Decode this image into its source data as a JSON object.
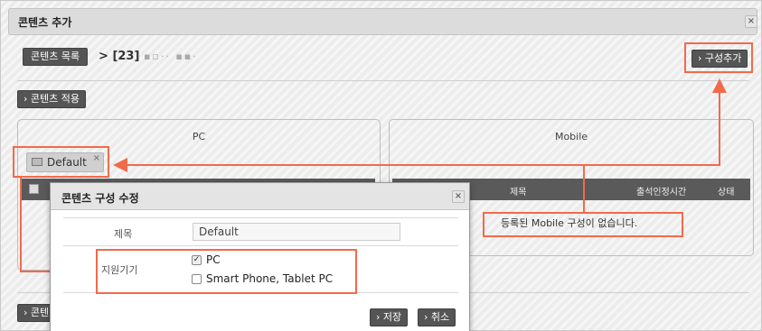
{
  "window": {
    "title": "콘텐츠 추가",
    "close": "×"
  },
  "breadcrumb": {
    "list_button": "콘텐츠 목록",
    "separator": ">",
    "current_id": "[23]",
    "current_title": "▪▫·· ▪▪·"
  },
  "toolbar": {
    "add_config": "› 구성추가",
    "apply_content": "› 콘텐츠 적용",
    "apply_content_cut": "› 콘텐"
  },
  "panels": {
    "pc": "PC",
    "mobile": "Mobile"
  },
  "pc_item": {
    "label": "Default",
    "remove": "×"
  },
  "mobile_grid": {
    "columns": [
      "제목",
      "출석인정시간",
      "상태"
    ],
    "empty": "등록된 Mobile 구성이 없습니다."
  },
  "modal": {
    "title": "콘텐츠 구성 수정",
    "close": "×",
    "title_label": "제목",
    "title_value": "Default",
    "device_label": "지원기기",
    "options": [
      {
        "label": "PC",
        "checked": true
      },
      {
        "label": "Smart Phone, Tablet PC",
        "checked": false
      }
    ],
    "save": "› 저장",
    "cancel": "› 취소"
  },
  "colors": {
    "annotation": "#f26a4a",
    "dark_button": "#555555"
  }
}
